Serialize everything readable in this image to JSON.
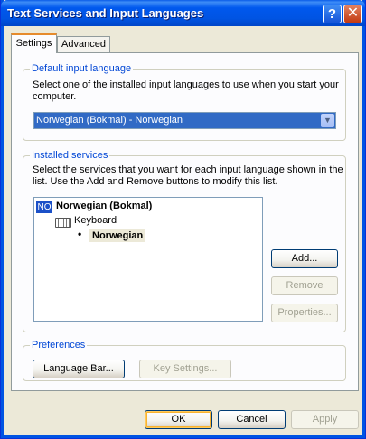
{
  "window": {
    "title": "Text Services and Input Languages"
  },
  "titlebar": {
    "help_glyph": "?",
    "close_glyph": "✕"
  },
  "tabs": [
    {
      "label": "Settings"
    },
    {
      "label": "Advanced"
    }
  ],
  "default_language": {
    "legend": "Default input language",
    "description_line1": "Select one of the installed input languages to use when you start your",
    "description_line2": "computer.",
    "selected": "Norwegian (Bokmal) - Norwegian"
  },
  "installed_services": {
    "legend": "Installed services",
    "description_line1": "Select the services that you want for each input language shown in the",
    "description_line2": "list. Use the Add and Remove buttons to modify this list.",
    "tree": {
      "language_abbr": "NO",
      "language": "Norwegian (Bokmal)",
      "category": "Keyboard",
      "bullet": "•",
      "layout": "Norwegian"
    },
    "buttons": {
      "add": "Add...",
      "remove": "Remove",
      "properties": "Properties..."
    }
  },
  "preferences": {
    "legend": "Preferences",
    "language_bar": "Language Bar...",
    "key_settings": "Key Settings..."
  },
  "footer": {
    "ok": "OK",
    "cancel": "Cancel",
    "apply": "Apply"
  }
}
